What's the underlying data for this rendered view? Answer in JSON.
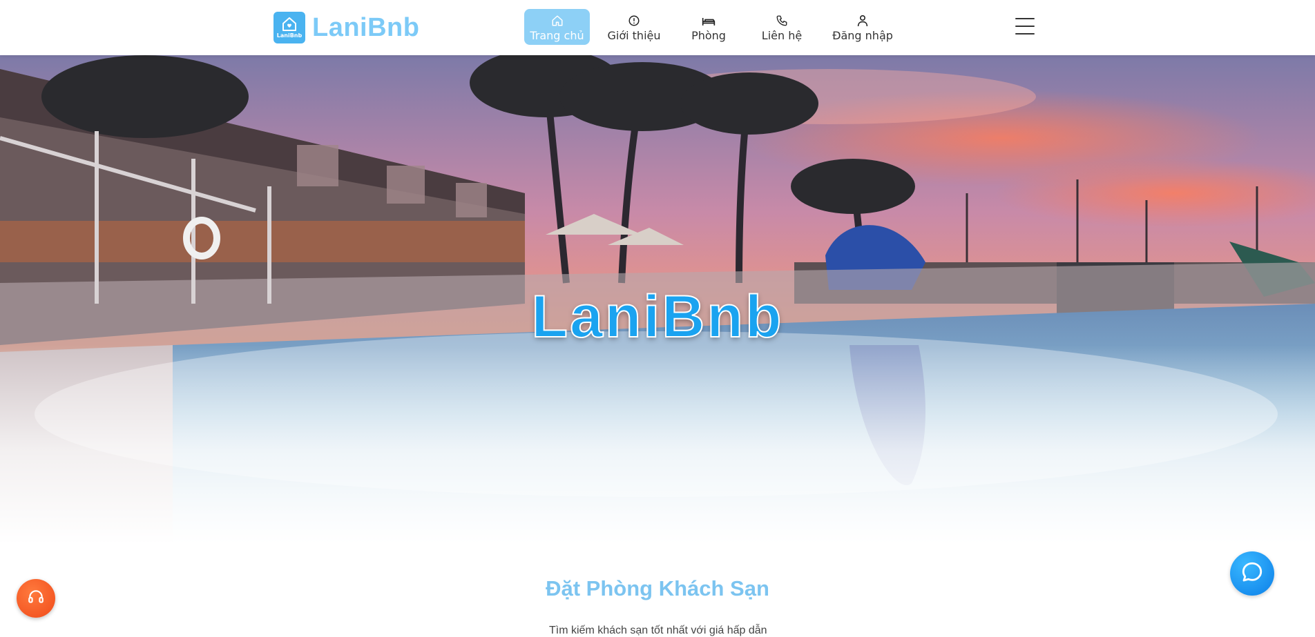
{
  "brand": {
    "logo_text": "LaniBnb",
    "name": "LaniBnb"
  },
  "nav": {
    "items": [
      {
        "label": "Trang chủ",
        "icon": "home-icon",
        "active": true
      },
      {
        "label": "Giới thiệu",
        "icon": "info-circle-icon",
        "active": false
      },
      {
        "label": "Phòng",
        "icon": "bed-icon",
        "active": false
      },
      {
        "label": "Liên hệ",
        "icon": "phone-icon",
        "active": false
      },
      {
        "label": "Đăng nhập",
        "icon": "user-icon",
        "active": false
      }
    ],
    "menu_icon": "hamburger-menu-icon"
  },
  "hero": {
    "title": "LaniBnb",
    "image": "hotel pool at sunset with palm trees"
  },
  "section": {
    "title": "Đặt Phòng Khách Sạn",
    "intro": "Tìm kiếm khách sạn tốt nhất với giá hấp dẫn"
  },
  "floating": {
    "support_icon": "headset-icon",
    "chat_icon": "chat-bubble-icon"
  },
  "colors": {
    "brand": "#7ccaf7",
    "active_nav": "#8dd0f6",
    "support_button": "#f04a1a",
    "chat_button": "#0c7fe8"
  }
}
